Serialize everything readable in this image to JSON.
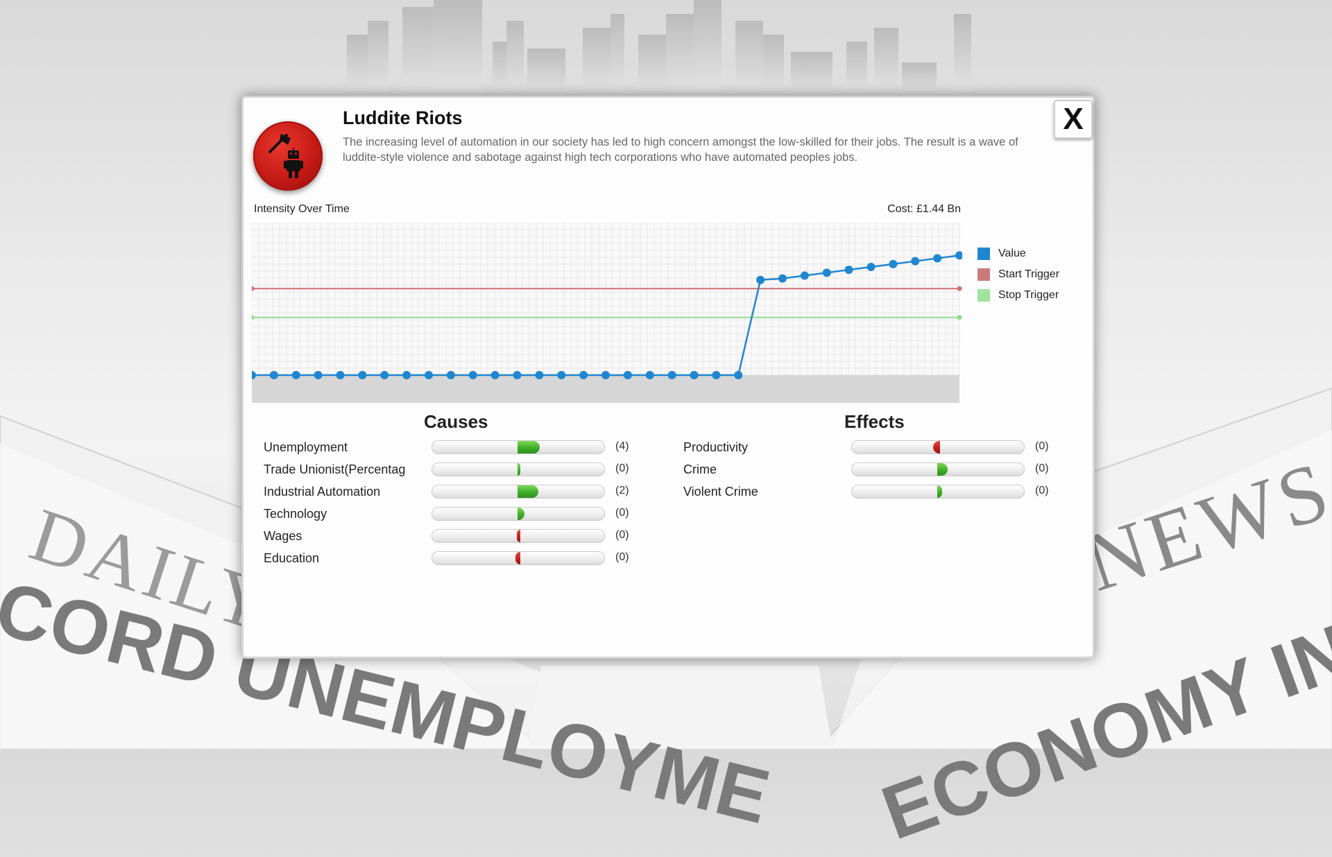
{
  "background": {
    "paper_left_masthead": "DAILY",
    "paper_left_headline": "CORD UNEMPLOYME",
    "paper_right_masthead": "NEWS",
    "paper_right_headline": "ECONOMY IN CR"
  },
  "dialog": {
    "title": "Luddite Riots",
    "description": "The increasing level of automation in our society has led to high concern amongst the low-skilled for their jobs. The result is a wave of luddite-style violence and sabotage against high tech corporations who have automated peoples jobs.",
    "close_label": "X",
    "icon": "axe-robot-icon",
    "icon_color": "#c61a15"
  },
  "chart_data": {
    "type": "line",
    "title": "Intensity Over Time",
    "cost_label": "Cost: £1.44 Bn",
    "ylim": [
      0,
      1
    ],
    "grid": true,
    "legend_placement": "right",
    "series": [
      {
        "name": "Value",
        "color": "#1f86d0",
        "values": [
          0,
          0,
          0,
          0,
          0,
          0,
          0,
          0,
          0,
          0,
          0,
          0,
          0,
          0,
          0,
          0,
          0,
          0,
          0,
          0,
          0,
          0,
          0,
          0.66,
          0.67,
          0.69,
          0.71,
          0.73,
          0.75,
          0.77,
          0.79,
          0.81,
          0.83
        ]
      },
      {
        "name": "Start Trigger",
        "color": "#cf6e6e",
        "constant": 0.6
      },
      {
        "name": "Stop Trigger",
        "color": "#8fdc8f",
        "constant": 0.4
      }
    ],
    "legend": [
      {
        "name": "Value",
        "color": "#1f86d0"
      },
      {
        "name": "Start Trigger",
        "color": "#c97b7b"
      },
      {
        "name": "Stop Trigger",
        "color": "#9fe39f"
      }
    ]
  },
  "causes": {
    "title": "Causes",
    "items": [
      {
        "label": "Unemployment",
        "value_text": "(4)",
        "amount": 0.13
      },
      {
        "label": "Trade Unionist(Percentag",
        "value_text": "(0)",
        "amount": 0.01
      },
      {
        "label": "Industrial Automation",
        "value_text": "(2)",
        "amount": 0.12
      },
      {
        "label": "Technology",
        "value_text": "(0)",
        "amount": 0.04
      },
      {
        "label": "Wages",
        "value_text": "(0)",
        "amount": -0.02
      },
      {
        "label": "Education",
        "value_text": "(0)",
        "amount": -0.03
      }
    ]
  },
  "effects": {
    "title": "Effects",
    "items": [
      {
        "label": "Productivity",
        "value_text": "(0)",
        "amount": -0.04
      },
      {
        "label": "Crime",
        "value_text": "(0)",
        "amount": 0.06
      },
      {
        "label": "Violent Crime",
        "value_text": "(0)",
        "amount": 0.03
      }
    ]
  }
}
